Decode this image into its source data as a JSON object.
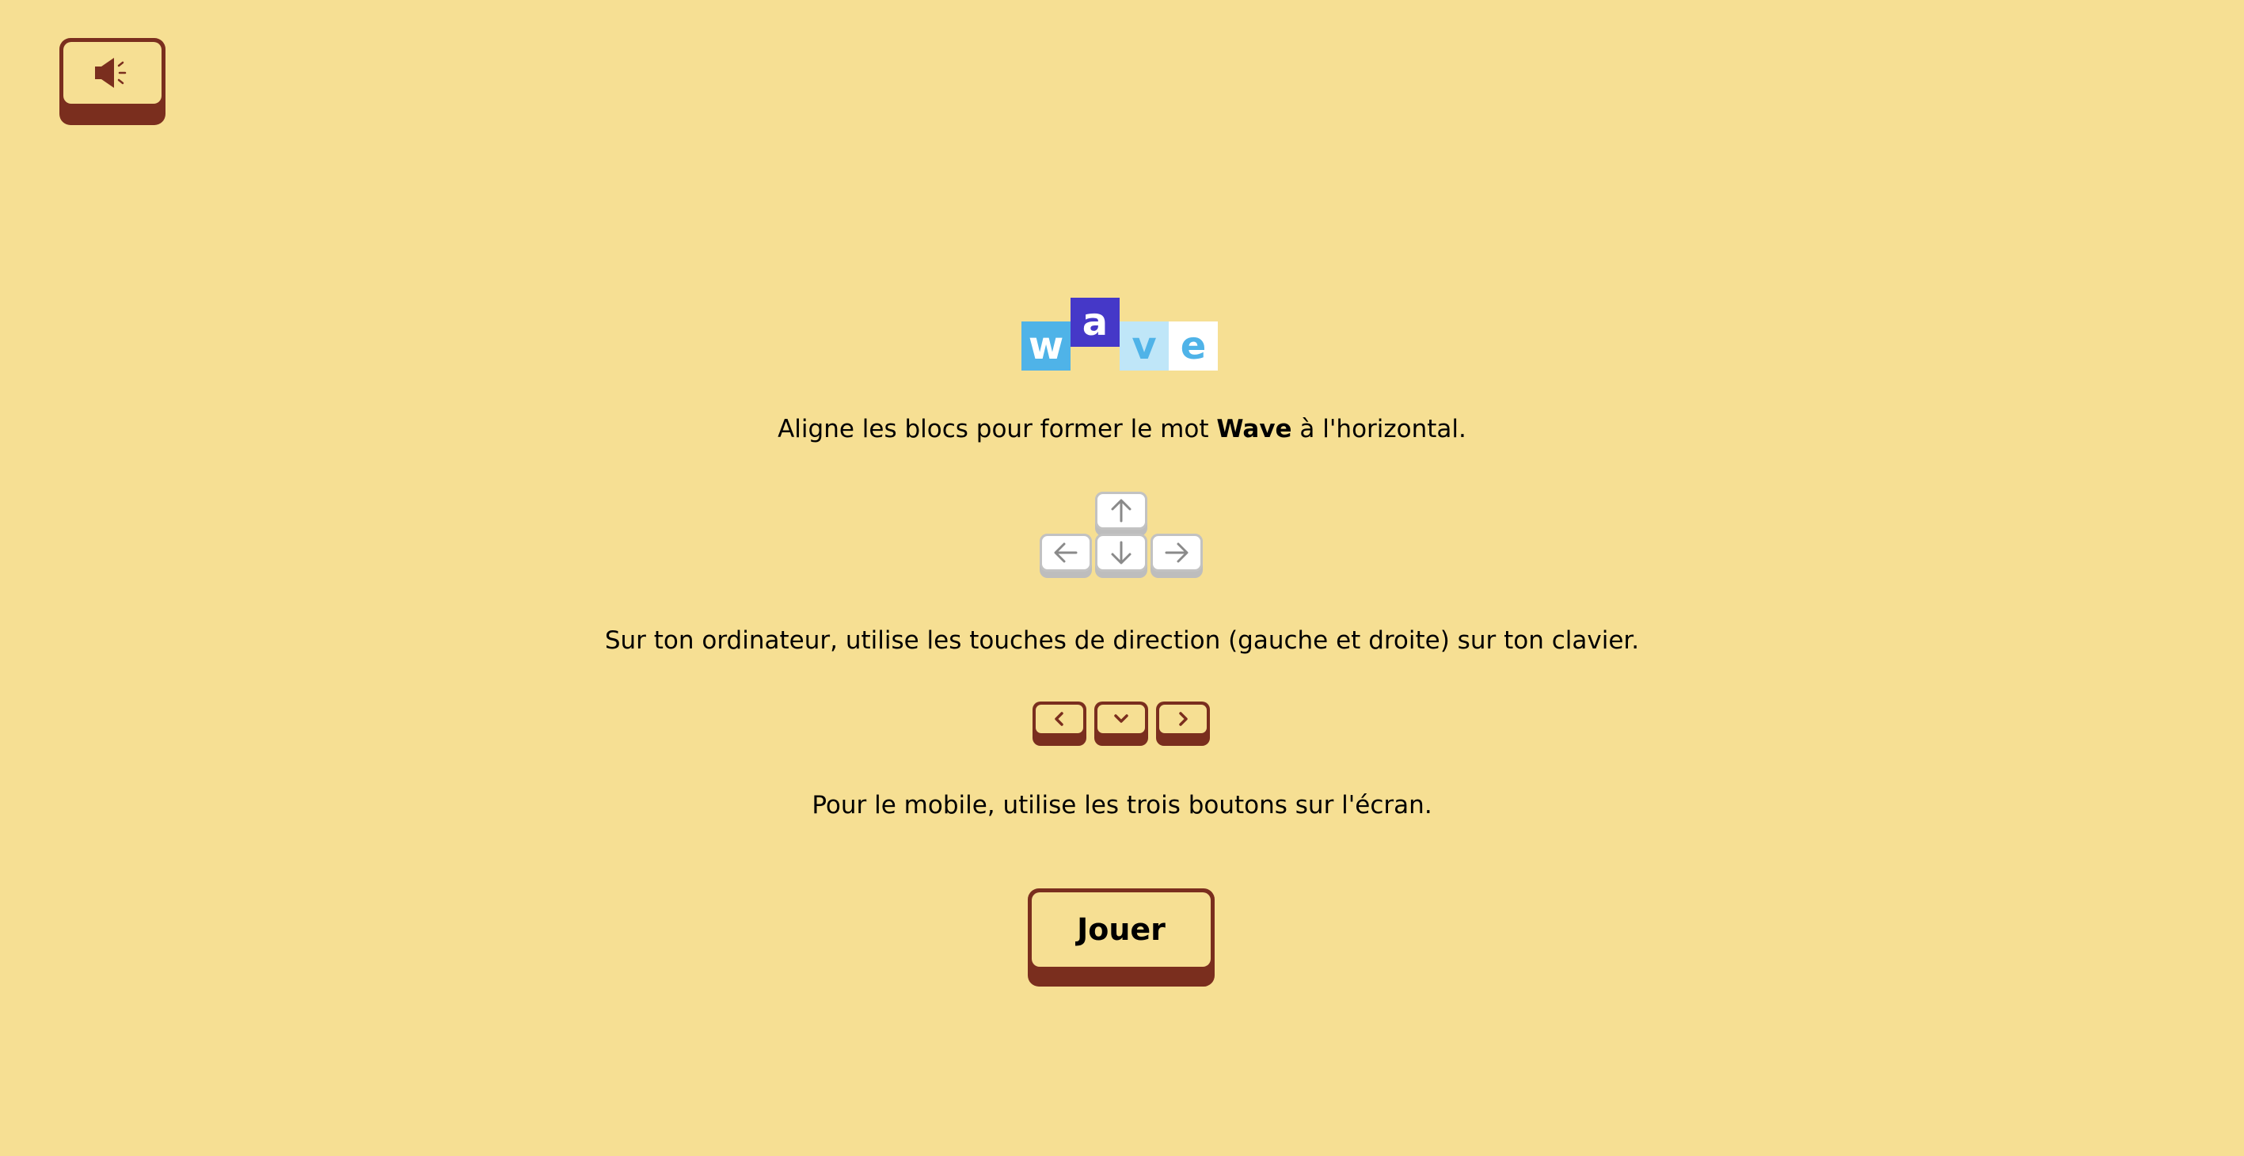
{
  "sound_button": {
    "icon": "speaker-icon"
  },
  "logo": {
    "letters": [
      "w",
      "a",
      "v",
      "e"
    ],
    "tile_colors": [
      "#4fb3e8",
      "#4538c8",
      "#bfe6f8",
      "#ffffff"
    ],
    "letter_colors": [
      "#ffffff",
      "#ffffff",
      "#4fb3e8",
      "#4fb3e8"
    ]
  },
  "instructions": {
    "line1_prefix": "Aligne les blocs pour former le mot ",
    "line1_word": "Wave",
    "line1_suffix": " à l'horizontal.",
    "line2": "Sur ton ordinateur, utilise les touches de direction (gauche et droite) sur ton clavier.",
    "line3": "Pour le mobile, utilise les trois boutons sur l'écran."
  },
  "keyboard_keys": [
    "arrow-up-icon",
    "arrow-left-icon",
    "arrow-down-icon",
    "arrow-right-icon"
  ],
  "mobile_buttons": [
    "chevron-left-icon",
    "chevron-down-icon",
    "chevron-right-icon"
  ],
  "play_button": {
    "label": "Jouer"
  },
  "colors": {
    "background": "#f6df93",
    "button_dark": "#7a2e1e"
  }
}
